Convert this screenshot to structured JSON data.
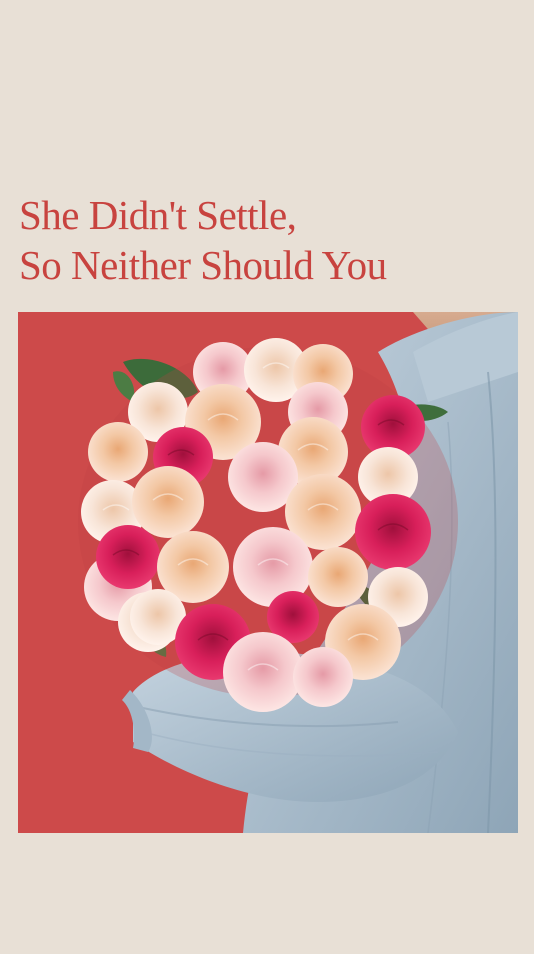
{
  "promo": {
    "headline_line1": "She Didn't Settle,",
    "headline_line2": "So Neither Should You"
  },
  "colors": {
    "page_background": "#e8e0d6",
    "headline": "#c8433f",
    "image_background": "#cd4a4a"
  }
}
